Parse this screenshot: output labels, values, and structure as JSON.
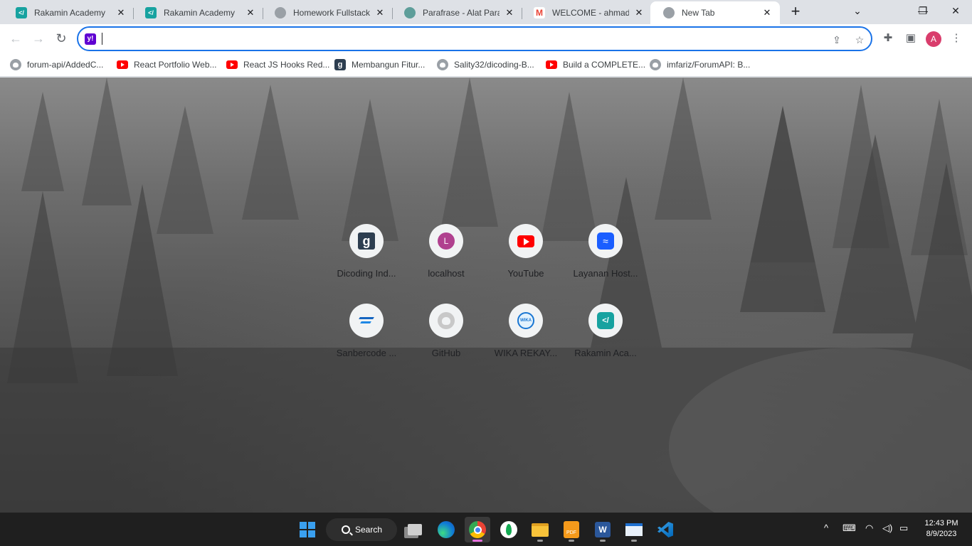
{
  "tabs": [
    {
      "title": "Rakamin Academy",
      "icon": "rakamin-icon"
    },
    {
      "title": "Rakamin Academy",
      "icon": "rakamin-icon"
    },
    {
      "title": "Homework Fullstack W",
      "icon": "globe-icon"
    },
    {
      "title": "Parafrase - Alat Parafra",
      "icon": "parafrase-icon"
    },
    {
      "title": "WELCOME - ahmad.sa",
      "icon": "gmail-icon"
    },
    {
      "title": "New Tab",
      "icon": "globe-icon",
      "active": true
    }
  ],
  "omnibox": {
    "value": "",
    "placeholder": ""
  },
  "profile": {
    "initial": "A",
    "color": "#d93d6c"
  },
  "bookmarks": [
    {
      "label": "forum-api/AddedC...",
      "icon": "github-icon"
    },
    {
      "label": "React Portfolio Web...",
      "icon": "youtube-icon"
    },
    {
      "label": "React JS Hooks Red...",
      "icon": "youtube-icon"
    },
    {
      "label": "Membangun Fitur...",
      "icon": "dicoding-icon"
    },
    {
      "label": "Sality32/dicoding-B...",
      "icon": "github-icon"
    },
    {
      "label": "Build a COMPLETE...",
      "icon": "youtube-icon"
    },
    {
      "label": "imfariz/ForumAPI: B...",
      "icon": "github-icon"
    }
  ],
  "shortcuts": [
    {
      "label": "Dicoding Ind...",
      "icon": "dicoding-icon"
    },
    {
      "label": "localhost",
      "icon": "letter-l-icon",
      "letter": "L"
    },
    {
      "label": "YouTube",
      "icon": "youtube-icon"
    },
    {
      "label": "Layanan Host...",
      "icon": "hosting-icon"
    },
    {
      "label": "Sanbercode ...",
      "icon": "sanbercode-icon"
    },
    {
      "label": "GitHub",
      "icon": "github-icon"
    },
    {
      "label": "WIKA REKAY...",
      "icon": "wika-icon"
    },
    {
      "label": "Rakamin Aca...",
      "icon": "rakamin-icon"
    }
  ],
  "taskbar": {
    "search_label": "Search",
    "time": "12:43 PM",
    "date": "8/9/2023",
    "apps": [
      "windows-start",
      "search",
      "task-view",
      "edge",
      "chrome",
      "mongodb-compass",
      "file-explorer",
      "pdf-app",
      "word",
      "media-app",
      "vscode"
    ]
  }
}
